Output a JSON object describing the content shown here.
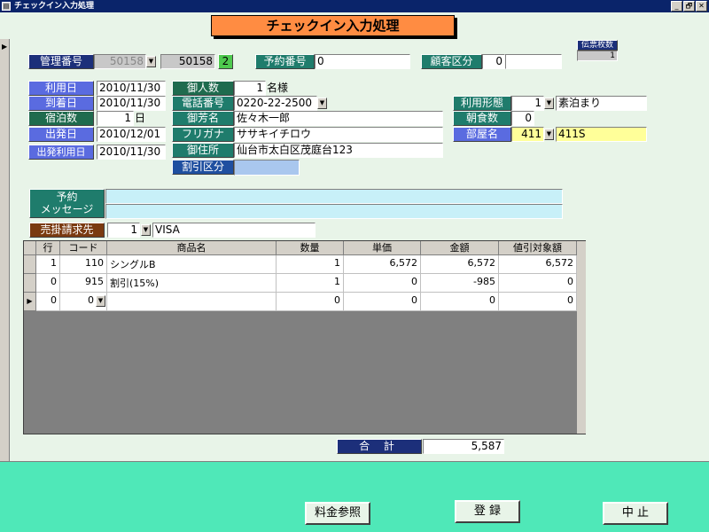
{
  "window": {
    "title": "チェックイン入力処理",
    "controls": [
      "_",
      "🗗",
      "✕"
    ]
  },
  "form_title": "チェックイン入力処理",
  "ticket_count": {
    "label": "伝票枚数",
    "value": "1"
  },
  "kanri": {
    "label": "管理番号",
    "combo_value": "50158",
    "value": "50158",
    "badge": "2"
  },
  "yoyaku": {
    "label": "予約番号",
    "value": "0"
  },
  "kokyaku": {
    "label": "顧客区分",
    "value": "0",
    "name": ""
  },
  "riyoubi": {
    "label": "利用日",
    "value": "2010/11/30"
  },
  "touchakubi": {
    "label": "到着日",
    "value": "2010/11/30"
  },
  "shukuhakusu": {
    "label": "宿泊数",
    "value": "1",
    "unit": "日"
  },
  "shuppatsubi": {
    "label": "出発日",
    "value": "2010/12/01"
  },
  "shuppatsu_riyoubi": {
    "label": "出発利用日",
    "value": "2010/11/30"
  },
  "ninzu": {
    "label": "御人数",
    "value": "1",
    "unit": "名様"
  },
  "denwa": {
    "label": "電話番号",
    "value": "0220-22-2500"
  },
  "namae": {
    "label": "御芳名",
    "value": "佐々木一郎"
  },
  "furigana": {
    "label": "フリガナ",
    "value": "ササキイチロウ"
  },
  "jusho": {
    "label": "御住所",
    "value": "仙台市太白区茂庭台123"
  },
  "waribiki": {
    "label": "割引区分",
    "value": ""
  },
  "riyou_keitai": {
    "label": "利用形態",
    "code": "1",
    "name": "素泊まり"
  },
  "choushoku": {
    "label": "朝食数",
    "value": "0"
  },
  "heya": {
    "label": "部屋名",
    "code": "411",
    "name": "411S"
  },
  "message": {
    "label_line1": "予約",
    "label_line2": "メッセージ",
    "line1": "",
    "line2": ""
  },
  "urikake": {
    "label": "売掛請求先",
    "code": "1",
    "name": "VISA"
  },
  "grid": {
    "headers": [
      "行",
      "コード",
      "商品名",
      "数量",
      "単価",
      "金額",
      "値引対象額"
    ],
    "rows": [
      [
        "1",
        "110",
        "シングルB",
        "1",
        "6,572",
        "6,572",
        "6,572"
      ],
      [
        "0",
        "915",
        "割引(15%)",
        "1",
        "0",
        "-985",
        "0"
      ],
      [
        "0",
        "0",
        "",
        "0",
        "0",
        "0",
        "0"
      ]
    ]
  },
  "total": {
    "label": "合 計",
    "value": "5,587"
  },
  "buttons": {
    "rates": "料金参照",
    "register": "登 録",
    "cancel": "中 止"
  }
}
